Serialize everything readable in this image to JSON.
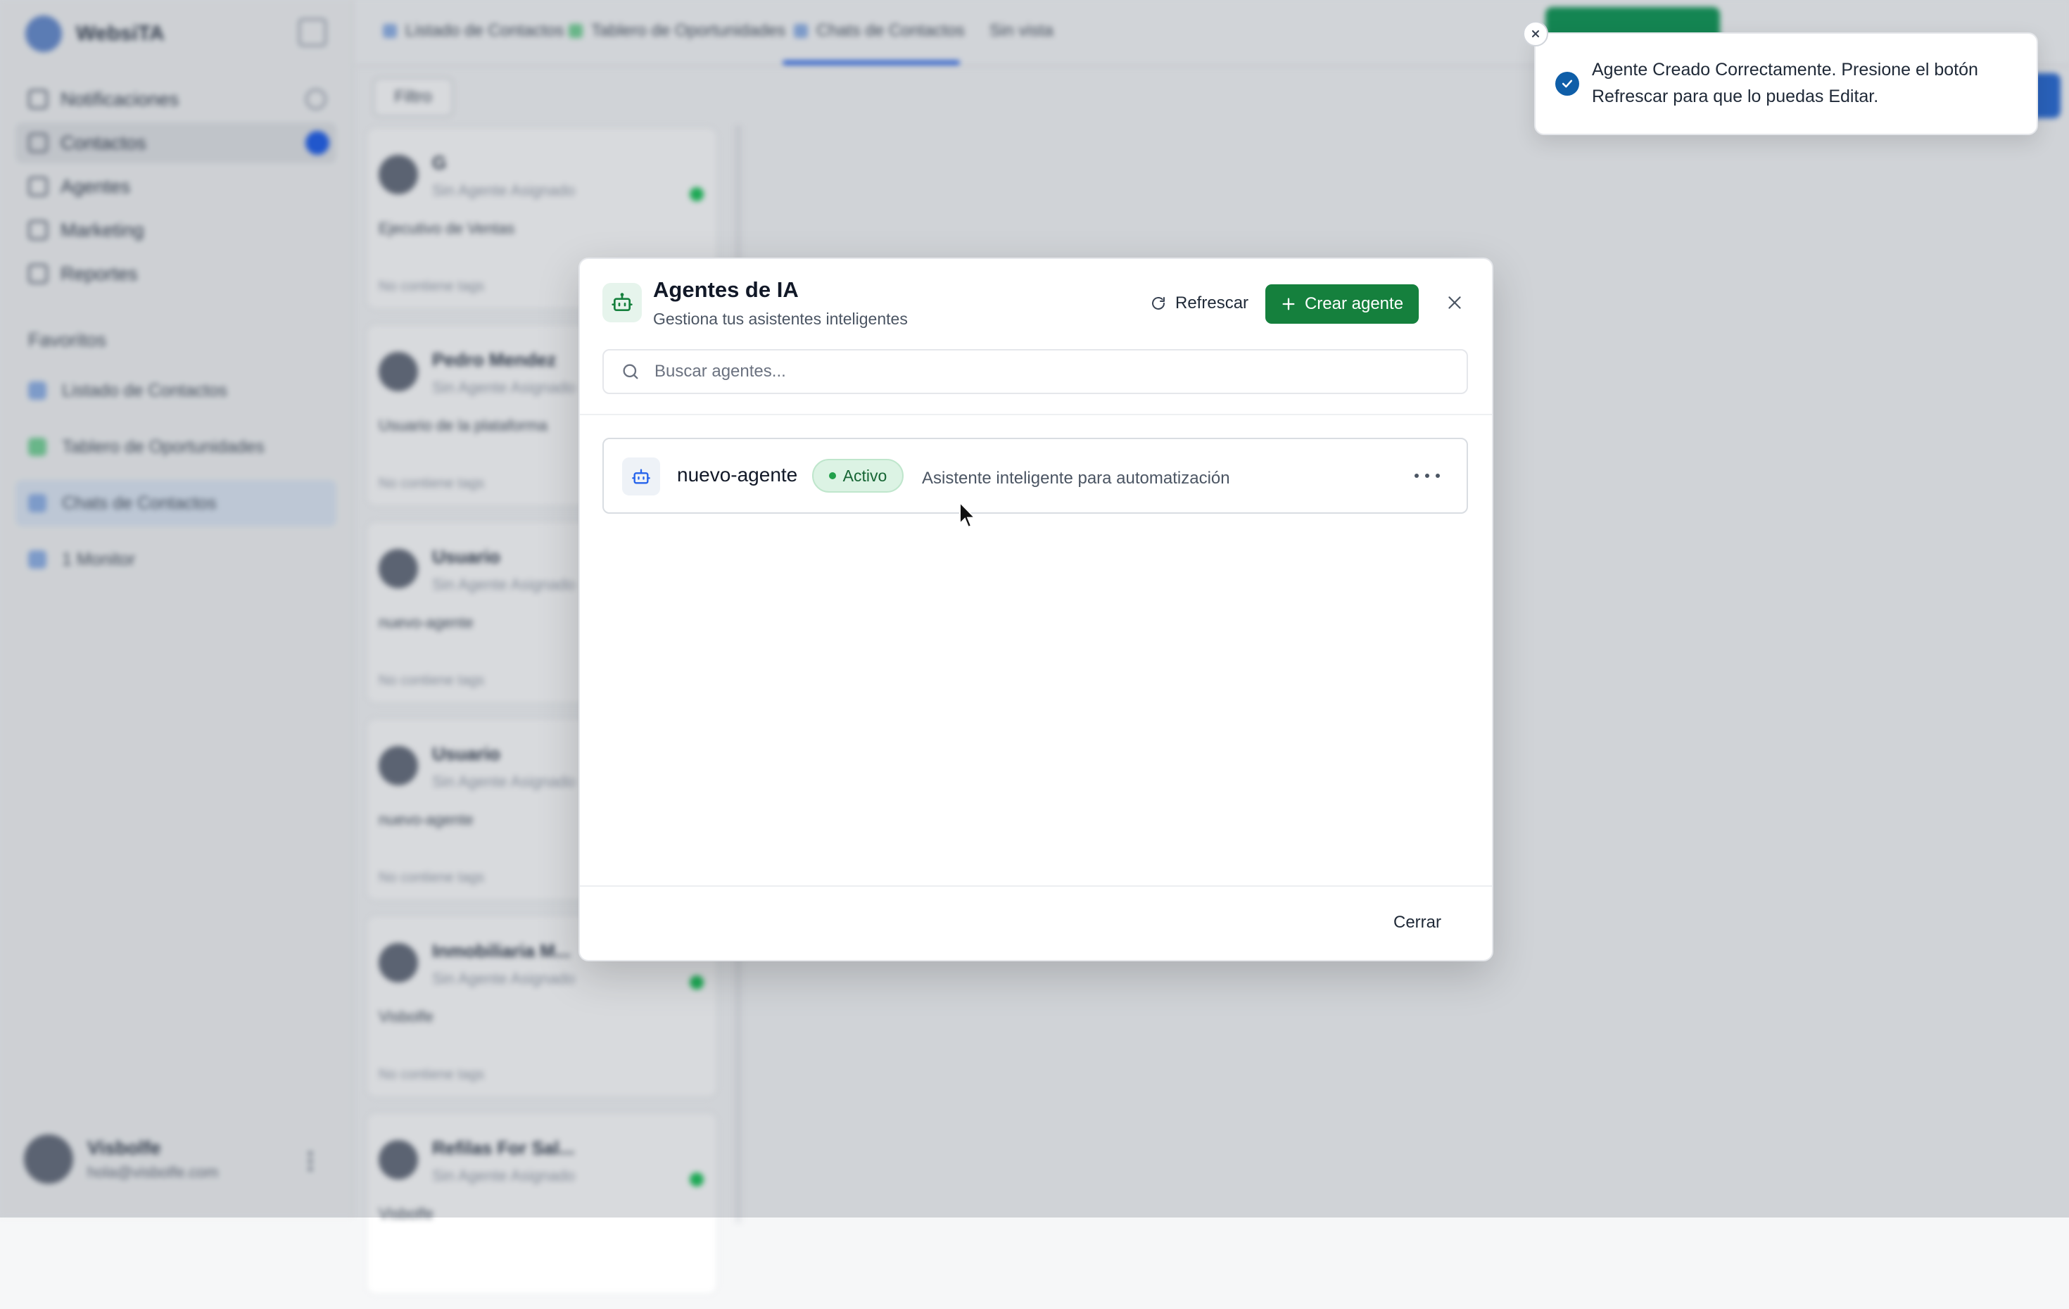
{
  "background": {
    "brand_name": "WebsiTA",
    "nav_items": [
      {
        "label": "Notificaciones"
      },
      {
        "label": "Contactos"
      },
      {
        "label": "Agentes"
      },
      {
        "label": "Marketing"
      },
      {
        "label": "Reportes"
      }
    ],
    "favorites_title": "Favoritos",
    "favorites": [
      {
        "label": "Listado de Contactos",
        "color": "#93b4e8"
      },
      {
        "label": "Tablero de Oportunidades",
        "color": "#7bd49b"
      },
      {
        "label": "Chats de Contactos",
        "color": "#93b4e8"
      },
      {
        "label": "1 Monitor",
        "color": "#93b4e8"
      }
    ],
    "user": {
      "name": "Visbolfe",
      "email": "hola@visbolfe.com"
    },
    "tabs": [
      {
        "label": "Listado de Contactos"
      },
      {
        "label": "Tablero de Oportunidades"
      },
      {
        "label": "Chats de Contactos"
      },
      {
        "label": "Sin vista"
      }
    ],
    "filters_label": "Filtro",
    "cards": [
      {
        "title": "G",
        "sub": "Sin Agente Asignado",
        "msg": "Ejecutivo de Ventas",
        "foot": "No contiene tags"
      },
      {
        "title": "Pedro Mendez",
        "sub": "Sin Agente Asignado",
        "msg": "Usuario de la plataforma",
        "foot": "No contiene tags"
      },
      {
        "title": "Usuario",
        "sub": "Sin Agente Asignado",
        "msg": "nuevo-agente",
        "foot": "No contiene tags"
      },
      {
        "title": "Usuario",
        "sub": "Sin Agente Asignado",
        "msg": "nuevo-agente",
        "foot": "No contiene tags"
      },
      {
        "title": "Inmobiliaria M...",
        "sub": "Sin Agente Asignado",
        "msg": "Visbolfe",
        "foot": "No contiene tags"
      },
      {
        "title": "Refilas For Sal...",
        "sub": "Sin Agente Asignado",
        "msg": "Visbolfe",
        "foot": ""
      }
    ]
  },
  "modal": {
    "title": "Agentes de IA",
    "subtitle": "Gestiona tus asistentes inteligentes",
    "refresh_label": "Refrescar",
    "create_label": "Crear agente",
    "search_placeholder": "Buscar agentes...",
    "agents": [
      {
        "name": "nuevo-agente",
        "status": "Activo",
        "description": "Asistente inteligente para automatización"
      }
    ],
    "close_label": "Cerrar"
  },
  "toast": {
    "message": "Agente Creado Correctamente. Presione el botón Refrescar para que lo puedas Editar."
  },
  "colors": {
    "primary_green": "#15803d",
    "status_green_bg": "#dcf3e4",
    "toast_check": "#0f5ea8"
  }
}
